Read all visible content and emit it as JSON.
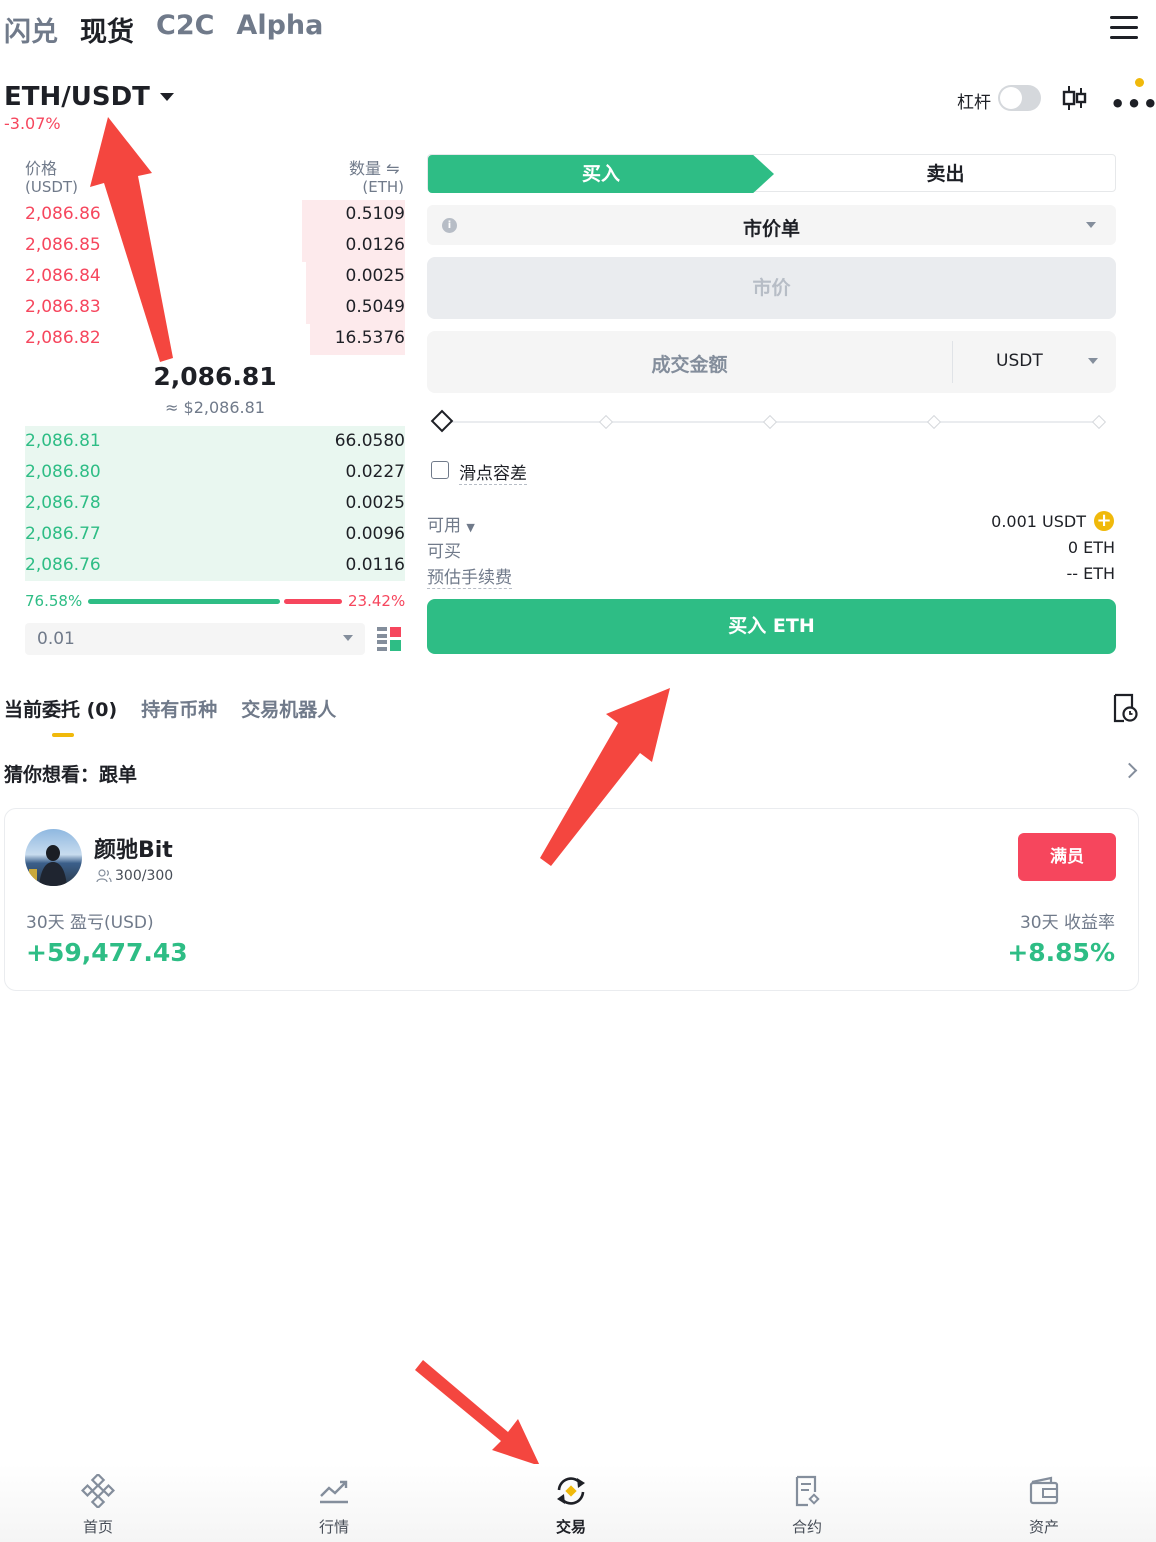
{
  "top_tabs": [
    "闪兑",
    "现货",
    "C2C",
    "Alpha"
  ],
  "pair": {
    "symbol": "ETH/USDT",
    "change": "-3.07%"
  },
  "header": {
    "leverage_label": "杠杆"
  },
  "order_book": {
    "price_header": "价格",
    "price_unit": "(USDT)",
    "qty_header": "数量",
    "qty_unit": "(ETH)",
    "asks": [
      {
        "price": "2,086.86",
        "qty": "0.5109",
        "depth": 0.27
      },
      {
        "price": "2,086.85",
        "qty": "0.0126",
        "depth": 0.27
      },
      {
        "price": "2,086.84",
        "qty": "0.0025",
        "depth": 0.26
      },
      {
        "price": "2,086.83",
        "qty": "0.5049",
        "depth": 0.26
      },
      {
        "price": "2,086.82",
        "qty": "16.5376",
        "depth": 0.25
      }
    ],
    "mid_price": "2,086.81",
    "mid_usd": "≈ $2,086.81",
    "bids": [
      {
        "price": "2,086.81",
        "qty": "66.0580"
      },
      {
        "price": "2,086.80",
        "qty": "0.0227"
      },
      {
        "price": "2,086.78",
        "qty": "0.0025"
      },
      {
        "price": "2,086.77",
        "qty": "0.0096"
      },
      {
        "price": "2,086.76",
        "qty": "0.0116"
      }
    ],
    "buy_ratio": "76.58%",
    "sell_ratio": "23.42%",
    "tick_size": "0.01"
  },
  "order_form": {
    "buy_tab": "买入",
    "sell_tab": "卖出",
    "order_type": "市价单",
    "price_placeholder": "市价",
    "amount_placeholder": "成交金额",
    "amount_currency": "USDT",
    "slippage_label": "滑点容差",
    "available_label": "可用",
    "available_value": "0.001 USDT",
    "max_buy_label": "可买",
    "max_buy_value": "0 ETH",
    "fee_label": "预估手续费",
    "fee_value": "-- ETH",
    "submit_label": "买入 ETH"
  },
  "lower_tabs": [
    "当前委托 (0)",
    "持有币种",
    "交易机器人"
  ],
  "recommend_label": "猜你想看：跟单",
  "copy_trade": {
    "trader_name": "颜驰Bit",
    "followers": "300/300",
    "status_button": "满员",
    "pnl_label": "30天 盈亏(USD)",
    "pnl_value": "+59,477.43",
    "roi_label": "30天 收益率",
    "roi_value": "+8.85%"
  },
  "bottom_nav": [
    "首页",
    "行情",
    "交易",
    "合约",
    "资产"
  ],
  "colors": {
    "green": "#2ebd85",
    "red": "#f6465d",
    "yellow": "#f0b90b",
    "arrow": "#f4463f"
  }
}
